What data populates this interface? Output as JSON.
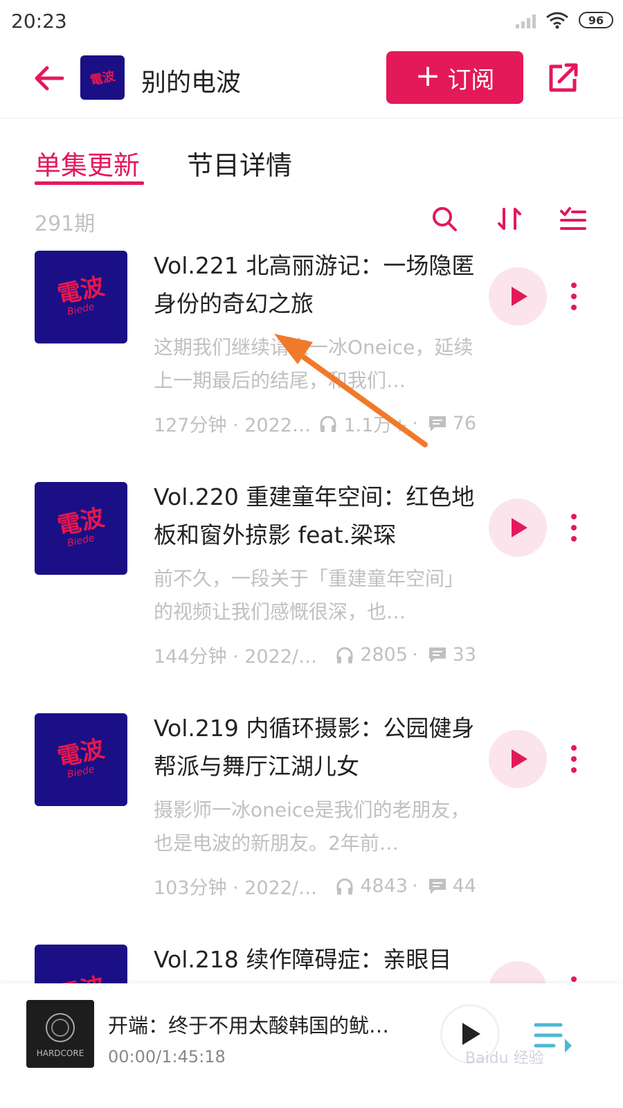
{
  "status_bar": {
    "time": "20:23",
    "battery": "96"
  },
  "header": {
    "podcast_title": "别的电波",
    "cover_text": "電波",
    "subscribe_label": "订阅"
  },
  "tabs": [
    {
      "label": "单集更新",
      "active": true
    },
    {
      "label": "节目详情",
      "active": false
    }
  ],
  "list": {
    "count_label": "291期"
  },
  "episodes": [
    {
      "title": "Vol.221 北高丽游记：一场隐匿身份的奇幻之旅",
      "description": "这期我们继续请来一冰Oneice，延续上一期最后的结尾，和我们…",
      "duration_date": "127分钟 · 2022…",
      "plays": "1.1万+",
      "comments": "76"
    },
    {
      "title": "Vol.220 重建童年空间：红色地板和窗外掠影 feat.梁琛",
      "description": "前不久，一段关于「重建童年空间」的视频让我们感慨很深，也…",
      "duration_date": "144分钟 · 2022/…",
      "plays": "2805",
      "comments": "33"
    },
    {
      "title": "Vol.219 内循环摄影：公园健身帮派与舞厅江湖儿女",
      "description": "摄影师一冰oneice是我们的老朋友，也是电波的新朋友。2年前…",
      "duration_date": "103分钟 · 2022/…",
      "plays": "4843",
      "comments": "44"
    },
    {
      "title": "Vol.218 续作障碍症：亲眼目",
      "description": "",
      "duration_date": "",
      "plays": "",
      "comments": ""
    }
  ],
  "cover_art": {
    "main": "電波",
    "sub": "Biede"
  },
  "player": {
    "title": "开端：终于不用太酸韩国的鱿…",
    "time": "00:00/1:45:18",
    "cover_text": "HARDCORE"
  },
  "watermark": "Baidu 经验",
  "colors": {
    "accent": "#e3195a",
    "cover_bg": "#1b0f86",
    "annotation_arrow": "#f07a2a"
  }
}
